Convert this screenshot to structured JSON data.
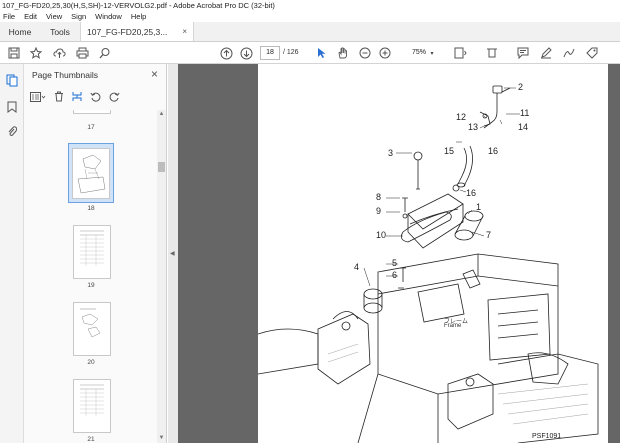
{
  "window": {
    "title": "107_FG-FD20,25,30(H,S,SH)-12-VERVOLG2.pdf - Adobe Acrobat Pro DC (32-bit)"
  },
  "menu": [
    "File",
    "Edit",
    "View",
    "Sign",
    "Window",
    "Help"
  ],
  "tabs": {
    "home": "Home",
    "tools": "Tools",
    "doc": "107_FG-FD20,25,3...",
    "close": "×"
  },
  "toolbar": {
    "page_current": "18",
    "page_total": "/ 126",
    "zoom": "75%"
  },
  "panel": {
    "title": "Page Thumbnails",
    "close": "×",
    "thumbs": [
      {
        "label": "17"
      },
      {
        "label": "18",
        "selected": true
      },
      {
        "label": "19"
      },
      {
        "label": "20"
      },
      {
        "label": "21"
      }
    ]
  },
  "diagram": {
    "callouts": [
      "2",
      "11",
      "12",
      "13",
      "14",
      "16",
      "3",
      "15",
      "16",
      "8",
      "9",
      "1",
      "10",
      "7",
      "4",
      "5",
      "6"
    ],
    "frame_label_jp": "フレーム",
    "frame_label": "Frame",
    "figure_code": "PSF1091"
  }
}
